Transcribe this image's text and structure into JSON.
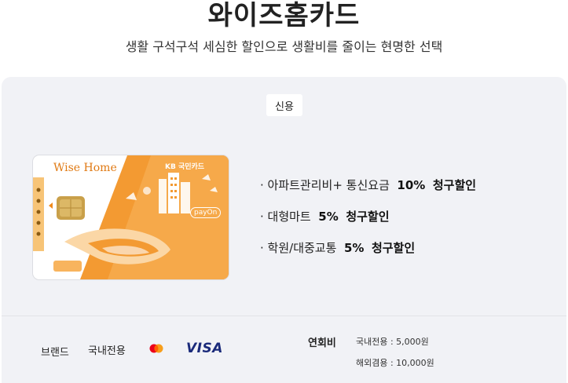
{
  "header": {
    "title": "와이즈홈카드",
    "subtitle": "생활 구석구석 세심한 할인으로 생활비를 줄이는 현명한 선택"
  },
  "card_type_badge": "신용",
  "card_image": {
    "brand_text": "Wise Home",
    "issuer_text": "KB 국민카드",
    "payon_text": "payOn",
    "accent_color": "#f39a32"
  },
  "benefits": [
    {
      "prefix": "· 아파트관리비+ 통신요금",
      "rate": "10%",
      "suffix": "청구할인"
    },
    {
      "prefix": "· 대형마트",
      "rate": "5%",
      "suffix": "청구할인"
    },
    {
      "prefix": "· 학원/대중교통",
      "rate": "5%",
      "suffix": "청구할인"
    }
  ],
  "footer": {
    "brand_label": "브랜드",
    "domestic_label": "국내전용",
    "mastercard_icon": "mastercard-logo",
    "visa_label": "VISA",
    "annual_fee_title": "연회비",
    "fees": [
      "국내전용 : 5,000원",
      "해외겸용 : 10,000원"
    ]
  }
}
